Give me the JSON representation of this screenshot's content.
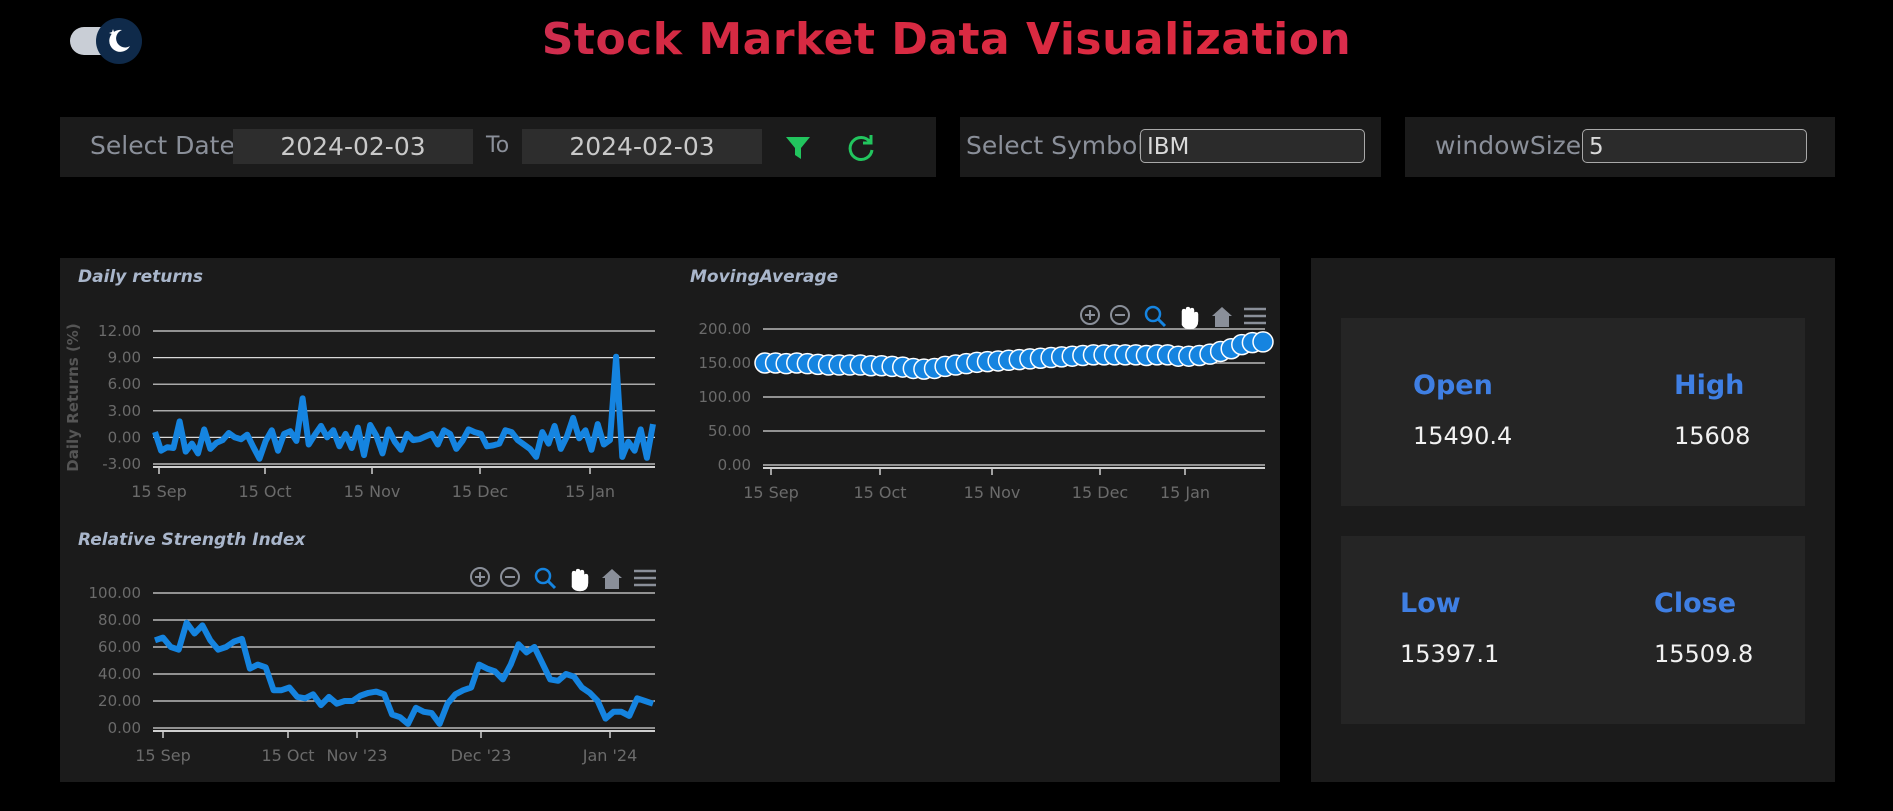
{
  "page": {
    "title": "Stock Market Data Visualization"
  },
  "filters": {
    "date_label": "Select Date",
    "date_from": "2024-02-03",
    "to_label": "To",
    "date_to": "2024-02-03",
    "symbol_label": "Select Symbol",
    "symbol_value": "IBM",
    "window_label": "windowSize",
    "window_value": "5"
  },
  "stats": {
    "open_label": "Open",
    "open_value": "15490.4",
    "high_label": "High",
    "high_value": "15608",
    "low_label": "Low",
    "low_value": "15397.1",
    "close_label": "Close",
    "close_value": "15509.8"
  },
  "colors": {
    "series": "#1584e0",
    "accent": "#3f7fe3",
    "filter": "#22c55e",
    "refresh": "#22c55e"
  },
  "icons": [
    "theme-toggle-icon",
    "filter-icon",
    "refresh-icon",
    "zoom-in-icon",
    "zoom-out-icon",
    "zoom-select-icon",
    "pan-icon",
    "home-icon",
    "menu-icon"
  ],
  "chart_data": [
    {
      "type": "line",
      "title": "Daily returns",
      "ylabel": "Daily Returns (%)",
      "xlabel": "",
      "ylim": [
        -3,
        12
      ],
      "yticks": [
        "12.00",
        "9.00",
        "6.00",
        "3.00",
        "0.00",
        "-3.00"
      ],
      "xticks": [
        "15 Sep",
        "15 Oct",
        "15 Nov",
        "15 Dec",
        "15 Jan"
      ],
      "series": [
        {
          "values": [
            0.6,
            -1.5,
            -1.1,
            -1.2,
            1.8,
            -1.6,
            -0.7,
            -1.8,
            0.9,
            -1.3,
            -0.6,
            -0.3,
            0.5,
            0.0,
            -0.2,
            0.3,
            -1.1,
            -2.4,
            -0.4,
            0.8,
            -1.5,
            0.4,
            0.7,
            -0.4,
            4.4,
            -0.8,
            0.3,
            1.3,
            0.0,
            0.8,
            -1.0,
            0.4,
            -1.2,
            1.1,
            -2.0,
            1.4,
            0.2,
            -1.8,
            0.9,
            -0.5,
            -1.4,
            0.4,
            -0.3,
            -0.2,
            0.1,
            0.4,
            -0.8,
            0.8,
            0.4,
            -1.3,
            -0.4,
            0.9,
            0.6,
            0.4,
            -1.0,
            -0.9,
            -0.7,
            0.8,
            0.6,
            -0.3,
            -0.8,
            -1.3,
            -2.2,
            0.6,
            -0.7,
            1.3,
            -1.3,
            0.1,
            2.2,
            -0.1,
            0.8,
            -1.4,
            1.5,
            -0.8,
            -0.3,
            9.1,
            -2.2,
            -0.5,
            -1.5,
            0.9,
            -2.3,
            1.5
          ]
        }
      ]
    },
    {
      "type": "scatter",
      "title": "MovingAverage",
      "ylim": [
        0,
        200
      ],
      "yticks": [
        "200.00",
        "150.00",
        "100.00",
        "50.00",
        "0.00"
      ],
      "xticks": [
        "15 Sep",
        "15 Oct",
        "15 Nov",
        "15 Dec",
        "15 Jan"
      ],
      "series": [
        {
          "values": [
            150,
            150,
            149,
            150,
            149,
            148,
            147,
            147,
            147,
            147,
            146,
            146,
            145,
            144,
            142,
            141,
            142,
            145,
            147,
            149,
            151,
            152,
            153,
            154,
            155,
            156,
            157,
            158,
            159,
            160,
            161,
            162,
            162,
            162,
            162,
            162,
            161,
            162,
            162,
            160,
            160,
            161,
            163,
            167,
            171,
            177,
            180,
            181
          ]
        }
      ]
    },
    {
      "type": "line",
      "title": "Relative Strength Index",
      "ylim": [
        0,
        100
      ],
      "yticks": [
        "100.00",
        "80.00",
        "60.00",
        "40.00",
        "20.00",
        "0.00"
      ],
      "xticks": [
        "15 Sep",
        "15 Oct",
        "Nov '23",
        "Dec '23",
        "Jan '24"
      ],
      "series": [
        {
          "values": [
            65,
            67,
            60,
            58,
            78,
            70,
            76,
            65,
            58,
            60,
            64,
            66,
            44,
            47,
            45,
            28,
            28,
            30,
            23,
            22,
            25,
            17,
            23,
            18,
            20,
            20,
            24,
            26,
            27,
            25,
            10,
            8,
            3,
            15,
            12,
            11,
            3,
            18,
            25,
            28,
            30,
            47,
            44,
            42,
            36,
            47,
            62,
            56,
            60,
            48,
            36,
            35,
            40,
            38,
            30,
            26,
            20,
            7,
            12,
            12,
            9,
            22,
            20,
            18
          ]
        }
      ]
    }
  ]
}
